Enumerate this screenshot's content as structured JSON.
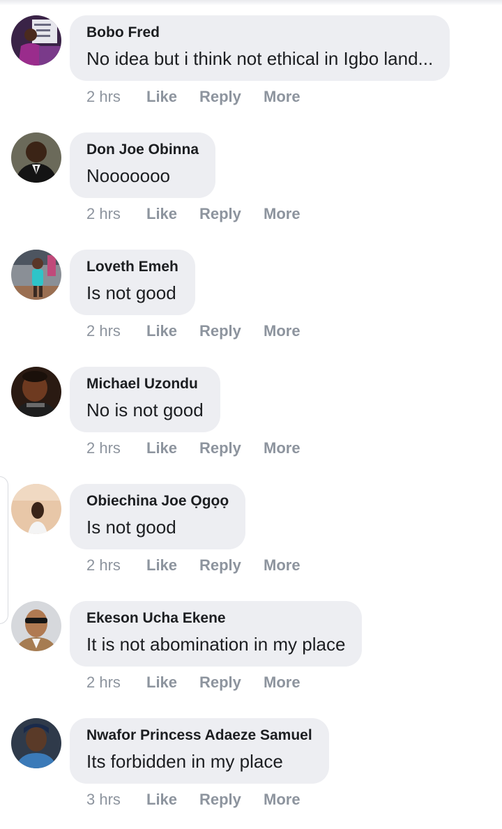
{
  "comments": [
    {
      "author": "Bobo Fred",
      "text": "No idea but i think not ethical in Igbo land...",
      "time": "2 hrs",
      "like": "Like",
      "reply": "Reply",
      "more": "More"
    },
    {
      "author": "Don Joe Obinna",
      "text": "Nooooooo",
      "time": "2 hrs",
      "like": "Like",
      "reply": "Reply",
      "more": "More"
    },
    {
      "author": "Loveth Emeh",
      "text": "Is not good",
      "time": "2 hrs",
      "like": "Like",
      "reply": "Reply",
      "more": "More"
    },
    {
      "author": "Michael Uzondu",
      "text": "No is not good",
      "time": "2 hrs",
      "like": "Like",
      "reply": "Reply",
      "more": "More"
    },
    {
      "author": "Obiechina Joe Ọgọọ",
      "text": "Is not good",
      "time": "2 hrs",
      "like": "Like",
      "reply": "Reply",
      "more": "More"
    },
    {
      "author": "Ekeson Ucha Ekene",
      "text": "It is not abomination in my place",
      "time": "2 hrs",
      "like": "Like",
      "reply": "Reply",
      "more": "More"
    },
    {
      "author": "Nwafor Princess Adaeze Samuel",
      "text": "Its forbidden in my place",
      "time": "3 hrs",
      "like": "Like",
      "reply": "Reply",
      "more": "More"
    }
  ],
  "colors": {
    "bubble": "#edeef2",
    "name_text": "#1c1e21",
    "meta_text": "#8d949e"
  }
}
